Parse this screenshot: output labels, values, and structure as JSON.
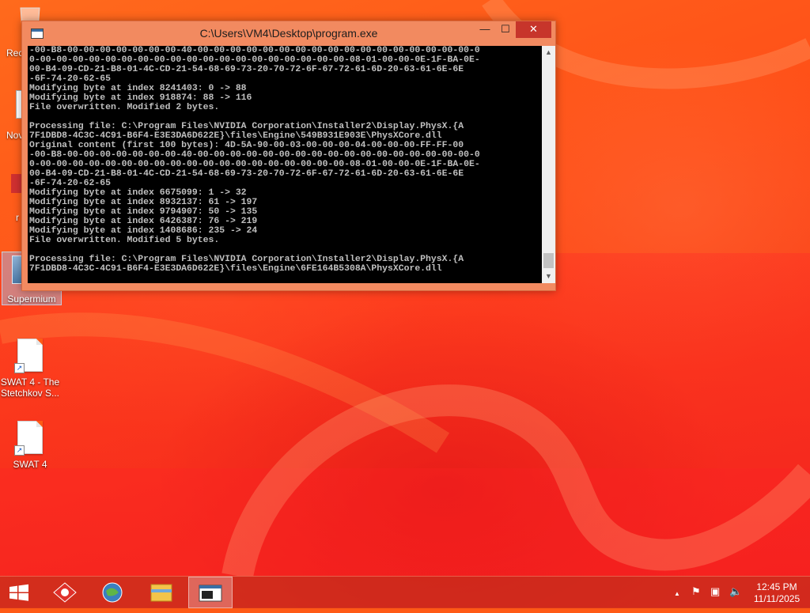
{
  "desktop": {
    "icons": [
      {
        "id": "recycle-bin",
        "label": "Rec"
      },
      {
        "id": "notepad",
        "label": "Nov"
      },
      {
        "id": "app-3",
        "label": "r"
      },
      {
        "id": "supermium",
        "label": "Supermium"
      },
      {
        "id": "swat4-stetchkov",
        "label": "SWAT 4 - The Stetchkov S..."
      },
      {
        "id": "swat4",
        "label": "SWAT 4"
      }
    ]
  },
  "window": {
    "title": "C:\\Users\\VM4\\Desktop\\program.exe",
    "minimize_glyph": "—",
    "maximize_glyph": "☐",
    "close_glyph": "✕",
    "scroll_up_glyph": "▲",
    "scroll_down_glyph": "▼",
    "console_lines": [
      "-00-B8-00-00-00-00-00-00-00-40-00-00-00-00-00-00-00-00-00-00-00-00-00-00-00-00-00-0",
      "0-00-00-00-00-00-00-00-00-00-00-00-00-00-00-00-00-00-00-00-08-01-00-00-0E-1F-BA-0E-",
      "00-B4-09-CD-21-B8-01-4C-CD-21-54-68-69-73-20-70-72-6F-67-72-61-6D-20-63-61-6E-6E",
      "-6F-74-20-62-65",
      "Modifying byte at index 8241403: 0 -> 88",
      "Modifying byte at index 918874: 88 -> 116",
      "File overwritten. Modified 2 bytes.",
      "",
      "Processing file: C:\\Program Files\\NVIDIA Corporation\\Installer2\\Display.PhysX.{A",
      "7F1DBD8-4C3C-4C91-B6F4-E3E3DA6D622E}\\files\\Engine\\549B931E903E\\PhysXCore.dll",
      "Original content (first 100 bytes): 4D-5A-90-00-03-00-00-00-04-00-00-00-FF-FF-00",
      "-00-B8-00-00-00-00-00-00-00-40-00-00-00-00-00-00-00-00-00-00-00-00-00-00-00-00-00-0",
      "0-00-00-00-00-00-00-00-00-00-00-00-00-00-00-00-00-00-00-00-08-01-00-00-0E-1F-BA-0E-",
      "00-B4-09-CD-21-B8-01-4C-CD-21-54-68-69-73-20-70-72-6F-67-72-61-6D-20-63-61-6E-6E",
      "-6F-74-20-62-65",
      "Modifying byte at index 6675099: 1 -> 32",
      "Modifying byte at index 8932137: 61 -> 197",
      "Modifying byte at index 9794907: 50 -> 135",
      "Modifying byte at index 6426387: 76 -> 219",
      "Modifying byte at index 1408686: 235 -> 24",
      "File overwritten. Modified 5 bytes.",
      "",
      "Processing file: C:\\Program Files\\NVIDIA Corporation\\Installer2\\Display.PhysX.{A",
      "7F1DBD8-4C3C-4C91-B6F4-E3E3DA6D622E}\\files\\Engine\\6FE164B5308A\\PhysXCore.dll"
    ]
  },
  "taskbar": {
    "start_glyph": "⊞",
    "tray_arrow": "▲",
    "flag_icon": "⚑",
    "network_icon": "▣",
    "volume_icon": "🔈",
    "time": "12:45 PM",
    "date": "11/11/2025"
  }
}
